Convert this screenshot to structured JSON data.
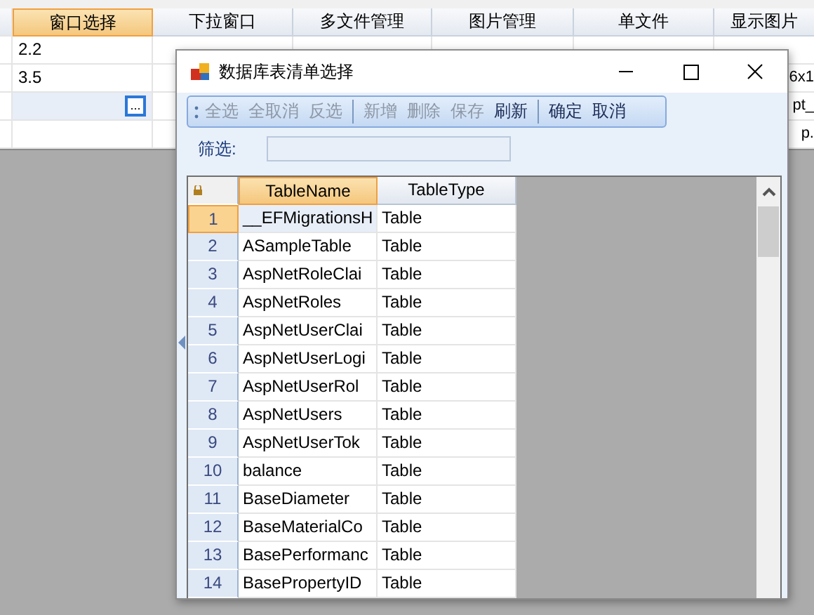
{
  "grid": {
    "columns": [
      {
        "label": "窗口选择",
        "selected": true
      },
      {
        "label": "下拉窗口",
        "selected": false
      },
      {
        "label": "多文件管理",
        "selected": false
      },
      {
        "label": "图片管理",
        "selected": false
      },
      {
        "label": "单文件",
        "selected": false
      },
      {
        "label": "显示图片",
        "selected": false
      }
    ],
    "rows": [
      {
        "selected": false,
        "window_select": "2.2"
      },
      {
        "selected": false,
        "window_select": "3.5",
        "display_image": "6x1"
      },
      {
        "selected": true,
        "button": "...",
        "display_image": "pt_"
      },
      {
        "selected": false,
        "display_image": "p."
      }
    ]
  },
  "dialog": {
    "title": "数据库表清单选择",
    "toolbar": [
      [
        {
          "label": "全选",
          "disabled": true
        },
        {
          "label": "全取消",
          "disabled": true
        },
        {
          "label": "反选",
          "disabled": true
        }
      ],
      [
        {
          "label": "新增",
          "disabled": true
        },
        {
          "label": "删除",
          "disabled": true
        },
        {
          "label": "保存",
          "disabled": true
        },
        {
          "label": "刷新",
          "disabled": false
        }
      ],
      [
        {
          "label": "确定",
          "disabled": false
        },
        {
          "label": "取消",
          "disabled": false
        }
      ]
    ],
    "filter": {
      "label": "筛选:"
    },
    "table": {
      "columns": [
        {
          "label": "TableName",
          "selected": true
        },
        {
          "label": "TableType",
          "selected": false
        }
      ],
      "rows": [
        {
          "number": "1",
          "name": "__EFMigrationsH",
          "type": "Table",
          "selected": true
        },
        {
          "number": "2",
          "name": "ASampleTable",
          "type": "Table",
          "selected": false
        },
        {
          "number": "3",
          "name": "AspNetRoleClai",
          "type": "Table",
          "selected": false
        },
        {
          "number": "4",
          "name": "AspNetRoles",
          "type": "Table",
          "selected": false
        },
        {
          "number": "5",
          "name": "AspNetUserClai",
          "type": "Table",
          "selected": false
        },
        {
          "number": "6",
          "name": "AspNetUserLogi",
          "type": "Table",
          "selected": false
        },
        {
          "number": "7",
          "name": "AspNetUserRol",
          "type": "Table",
          "selected": false
        },
        {
          "number": "8",
          "name": "AspNetUsers",
          "type": "Table",
          "selected": false
        },
        {
          "number": "9",
          "name": "AspNetUserTok",
          "type": "Table",
          "selected": false
        },
        {
          "number": "10",
          "name": "balance",
          "type": "Table",
          "selected": false
        },
        {
          "number": "11",
          "name": "BaseDiameter",
          "type": "Table",
          "selected": false
        },
        {
          "number": "12",
          "name": "BaseMaterialCo",
          "type": "Table",
          "selected": false
        },
        {
          "number": "13",
          "name": "BasePerformanc",
          "type": "Table",
          "selected": false
        },
        {
          "number": "14",
          "name": "BasePropertyID",
          "type": "Table",
          "selected": false
        }
      ]
    }
  }
}
